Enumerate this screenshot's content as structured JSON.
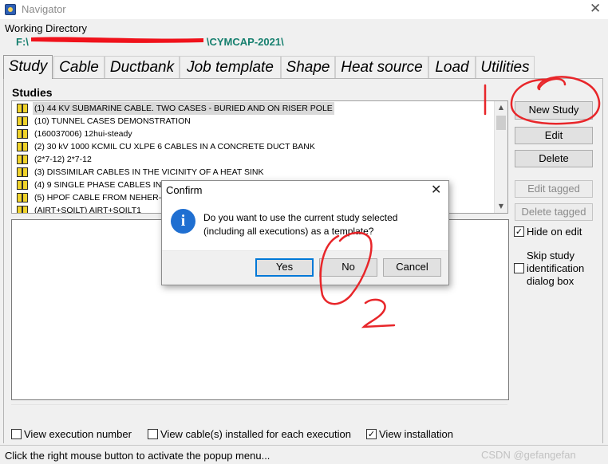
{
  "window": {
    "title": "Navigator",
    "close_glyph": "✕"
  },
  "working_directory": {
    "label": "Working Directory",
    "path_prefix": "F:\\",
    "path_suffix": "\\CYMCAP-2021\\"
  },
  "tabs": [
    {
      "label": "Study",
      "active": true
    },
    {
      "label": "Cable"
    },
    {
      "label": "Ductbank"
    },
    {
      "label": "Job template"
    },
    {
      "label": "Shape"
    },
    {
      "label": "Heat source"
    },
    {
      "label": "Load"
    },
    {
      "label": "Utilities"
    }
  ],
  "studies": {
    "label": "Studies",
    "items": [
      "(1) 44 KV SUBMARINE CABLE. TWO CASES - BURIED AND ON RISER POLE",
      "(10) TUNNEL CASES DEMONSTRATION",
      "(160037006) 12hui-steady",
      "(2) 30 kV 1000 KCMIL CU XLPE 6 CABLES IN A CONCRETE DUCT BANK",
      "(2*7-12) 2*7-12",
      "(3) DISSIMILAR CABLES IN THE VICINITY OF A HEAT SINK",
      "(4) 9 SINGLE PHASE CABLES IN 3",
      "(5) HPOF CABLE FROM NEHER-MC",
      "(AIRT+SOILT) AIRT+SOILT1"
    ]
  },
  "buttons": {
    "new_study": "New Study",
    "edit": "Edit",
    "delete": "Delete",
    "edit_tagged": "Edit tagged",
    "delete_tagged": "Delete tagged"
  },
  "options": {
    "hide_on_edit": {
      "label": "Hide on edit",
      "checked": true
    },
    "skip_study": {
      "label": "Skip study identification dialog box",
      "checked": false
    },
    "view_execution_number": {
      "label": "View execution number",
      "checked": false
    },
    "view_cables": {
      "label": "View cable(s) installed for each execution",
      "checked": false
    },
    "view_installation": {
      "label": "View installation",
      "checked": true
    }
  },
  "status_bar": {
    "text": "Click the right mouse button to activate the popup menu...",
    "watermark": "CSDN @gefangefan"
  },
  "dialog": {
    "title": "Confirm",
    "close_glyph": "✕",
    "icon": "info-icon",
    "message_line1": "Do you want to use the current study selected",
    "message_line2": "(including all executions) as a template?",
    "yes": "Yes",
    "no": "No",
    "cancel": "Cancel"
  },
  "annotations": {
    "mark_1": "1",
    "mark_2": "2"
  },
  "colors": {
    "path_text": "#17806f",
    "annotation_red": "#e8262a",
    "dialog_info_blue": "#1f6fd1"
  }
}
